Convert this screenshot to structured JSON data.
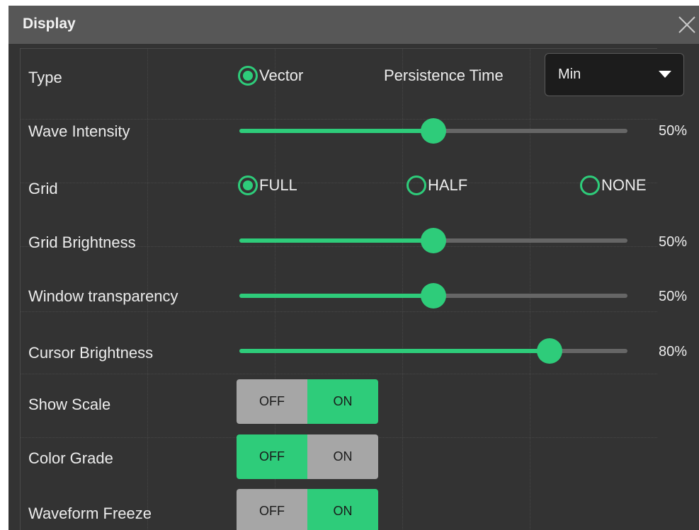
{
  "dialog": {
    "title": "Display",
    "close_icon": "close-icon"
  },
  "type_row": {
    "label": "Type",
    "option": "Vector",
    "persistence_label": "Persistence Time",
    "persistence_value": "Min"
  },
  "wave_intensity": {
    "label": "Wave Intensity",
    "value_text": "50%",
    "value": 0.5
  },
  "grid": {
    "label": "Grid",
    "options": [
      "FULL",
      "HALF",
      "NONE"
    ],
    "selected": "FULL"
  },
  "grid_brightness": {
    "label": "Grid Brightness",
    "value_text": "50%",
    "value": 0.5
  },
  "window_transparency": {
    "label": "Window transparency",
    "value_text": "50%",
    "value": 0.5
  },
  "cursor_brightness": {
    "label": "Cursor Brightness",
    "value_text": "80%",
    "value": 0.8
  },
  "show_scale": {
    "label": "Show Scale",
    "off": "OFF",
    "on": "ON",
    "state": "ON"
  },
  "color_grade": {
    "label": "Color Grade",
    "off": "OFF",
    "on": "ON",
    "state": "OFF"
  },
  "waveform_freeze": {
    "label": "Waveform Freeze",
    "off": "OFF",
    "on": "ON",
    "state": "ON"
  },
  "colors": {
    "accent": "#2ecc7a",
    "panel_bg": "#333333",
    "titlebar_bg": "#575757",
    "toggle_inactive": "#a6a6a6"
  }
}
